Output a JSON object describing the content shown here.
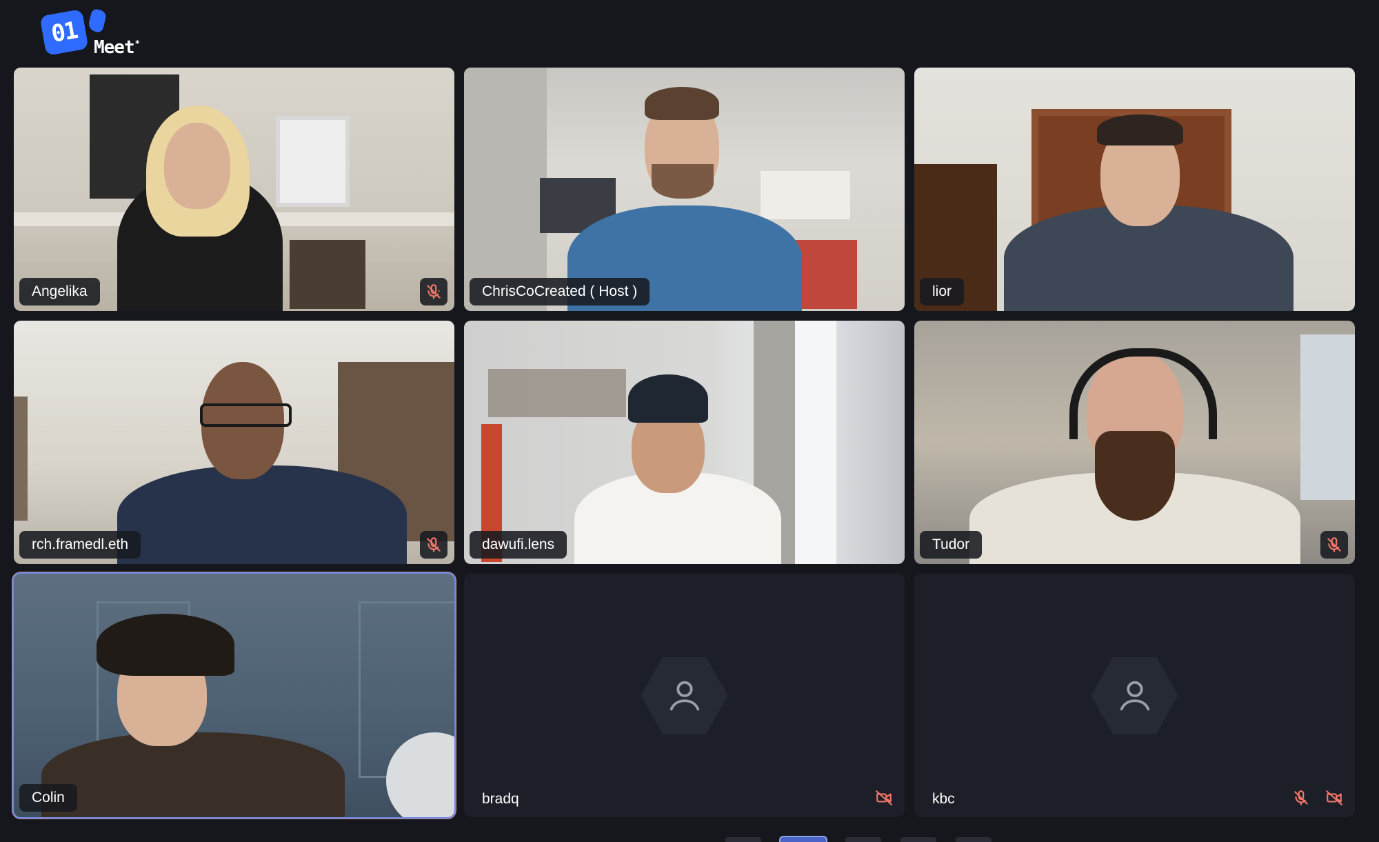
{
  "app": {
    "logo_mark": "01",
    "logo_word": "Meet",
    "logo_sup": "*"
  },
  "participants": [
    {
      "name": "Angelika",
      "style": "pill",
      "muted": true,
      "camera_off": false,
      "video": true
    },
    {
      "name": "ChrisCoCreated ( Host )",
      "style": "pill",
      "muted": false,
      "camera_off": false,
      "video": true
    },
    {
      "name": "lior",
      "style": "pill",
      "muted": false,
      "camera_off": false,
      "video": true
    },
    {
      "name": "rch.framedl.eth",
      "style": "pill",
      "muted": true,
      "camera_off": false,
      "video": true
    },
    {
      "name": "dawufi.lens",
      "style": "pill",
      "muted": false,
      "camera_off": false,
      "video": true
    },
    {
      "name": "Tudor",
      "style": "pill",
      "muted": true,
      "camera_off": false,
      "video": true
    },
    {
      "name": "Colin",
      "style": "pill",
      "muted": false,
      "camera_off": false,
      "video": true,
      "active_speaker": true
    },
    {
      "name": "bradq",
      "style": "plain",
      "muted": false,
      "camera_off": true,
      "video": false
    },
    {
      "name": "kbc",
      "style": "plain",
      "muted": true,
      "camera_off": true,
      "video": false
    }
  ],
  "icons": {
    "muted": "mic-off-icon",
    "camera_off": "camera-off-icon",
    "avatar": "user-avatar-icon"
  },
  "colors": {
    "background": "#15171c",
    "tile": "#1c1f27",
    "alert_icon": "#f2766a",
    "accent": "#2f6bff",
    "active_border": "#c78a8f"
  }
}
